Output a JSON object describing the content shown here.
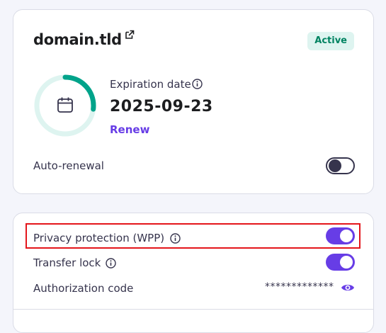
{
  "domain_card": {
    "domain": "domain.tld",
    "status_badge": "Active",
    "expiration_label": "Expiration date",
    "expiration_date": "2025-09-23",
    "renew_label": "Renew",
    "days_remaining_fraction": 0.27,
    "auto_renewal_label": "Auto-renewal",
    "auto_renewal_on": false
  },
  "settings_card": {
    "privacy_label": "Privacy protection (WPP)",
    "privacy_on": true,
    "transfer_lock_label": "Transfer lock",
    "transfer_lock_on": true,
    "auth_code_label": "Authorization code",
    "auth_code_value": "*************"
  },
  "colors": {
    "accent": "#673de6",
    "success": "#00b090",
    "badge_bg": "#def4f0",
    "highlight": "#e4161b"
  }
}
